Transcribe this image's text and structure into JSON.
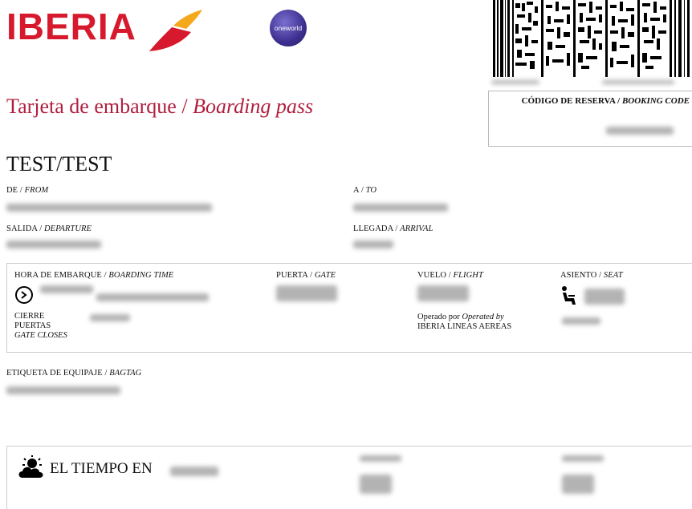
{
  "header": {
    "logo_text": "IBERIA",
    "alliance_badge": "oneworld"
  },
  "title": {
    "spanish": "Tarjeta de embarque / ",
    "english": "Boarding pass"
  },
  "booking": {
    "label_es": "CÓDIGO DE RESERVA / ",
    "label_en": "BOOKING CODE"
  },
  "passenger": {
    "name": "TEST/TEST"
  },
  "fields": {
    "from_es": "DE / ",
    "from_en": "FROM",
    "to_es": "A / ",
    "to_en": "TO",
    "departure_es": "SALIDA / ",
    "departure_en": "DEPARTURE",
    "arrival_es": "LLEGADA / ",
    "arrival_en": "ARRIVAL",
    "boarding_time_es": "HORA DE EMBARQUE / ",
    "boarding_time_en": "BOARDING TIME",
    "gate_es": "PUERTA / ",
    "gate_en": "GATE",
    "flight_es": "VUELO / ",
    "flight_en": "FLIGHT",
    "seat_es": "ASIENTO / ",
    "seat_en": "SEAT",
    "gate_closes_line1": "CIERRE",
    "gate_closes_line2": "PUERTAS",
    "gate_closes_en": "GATE CLOSES",
    "operated_es": "Operado por ",
    "operated_en": "Operated by",
    "operator": "IBERIA LINEAS AEREAS",
    "bagtag_es": "ETIQUETA DE EQUIPAJE / ",
    "bagtag_en": "BAGTAG"
  },
  "weather": {
    "title": "EL TIEMPO EN"
  },
  "icons": {
    "clock": "clock-icon",
    "seat": "seat-icon",
    "weather": "weather-icon",
    "barcode": "barcode-icon"
  },
  "colors": {
    "brand_red": "#d7192d",
    "title_red": "#b01e3d",
    "oneworld": "#3d2f8f"
  }
}
